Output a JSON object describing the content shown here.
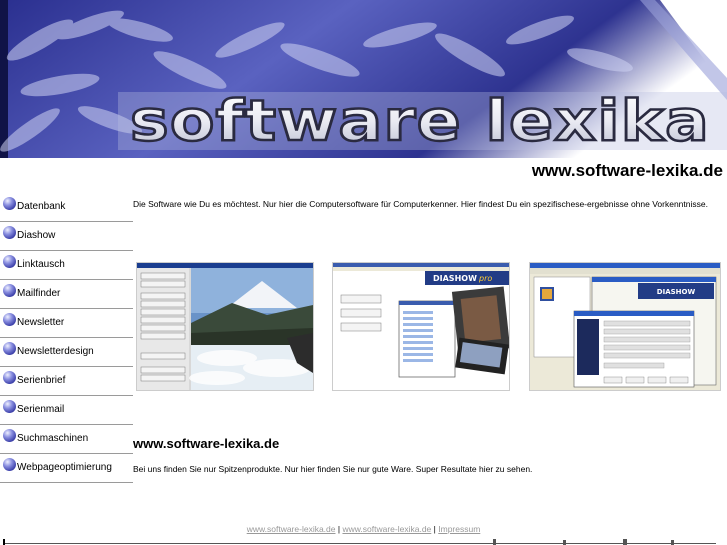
{
  "header": {
    "logo_text": "software lexika",
    "site_url": "www.software-lexika.de"
  },
  "nav": {
    "items": [
      {
        "label": "Datenbank"
      },
      {
        "label": "Diashow"
      },
      {
        "label": "Linktausch"
      },
      {
        "label": "Mailfinder"
      },
      {
        "label": "Newsletter"
      },
      {
        "label": "Newsletterdesign"
      },
      {
        "label": "Serienbrief"
      },
      {
        "label": "Serienmail"
      },
      {
        "label": "Suchmaschinen"
      },
      {
        "label": "Webpageoptimierung"
      }
    ]
  },
  "main": {
    "intro": "Die Software wie Du es möchtest. Nur hier die Computersoftware für Computerkenner. Hier findest Du ein spezifischese-ergebnisse ohne Vorkenntnisse.",
    "section_title": "www.software-lexika.de",
    "section_text": "Bei uns finden Sie nur Spitzenprodukte. Nur hier finden Sie nur gute Ware. Super Resultate hier zu sehen."
  },
  "screenshots": {
    "diashow_logo": "DIASHOW",
    "diashow_logo_pro": "pro"
  },
  "footer": {
    "link1": "www.software-lexika.de",
    "separator": "|",
    "link2": "www.software-lexika.de",
    "link3": "Impressum"
  },
  "colors": {
    "banner_dark": "#1b1f78",
    "banner_mid": "#6c74c8",
    "banner_light": "#e8eaf8",
    "nav_bullet": "#3a3ea8",
    "footer_link": "#999999"
  }
}
